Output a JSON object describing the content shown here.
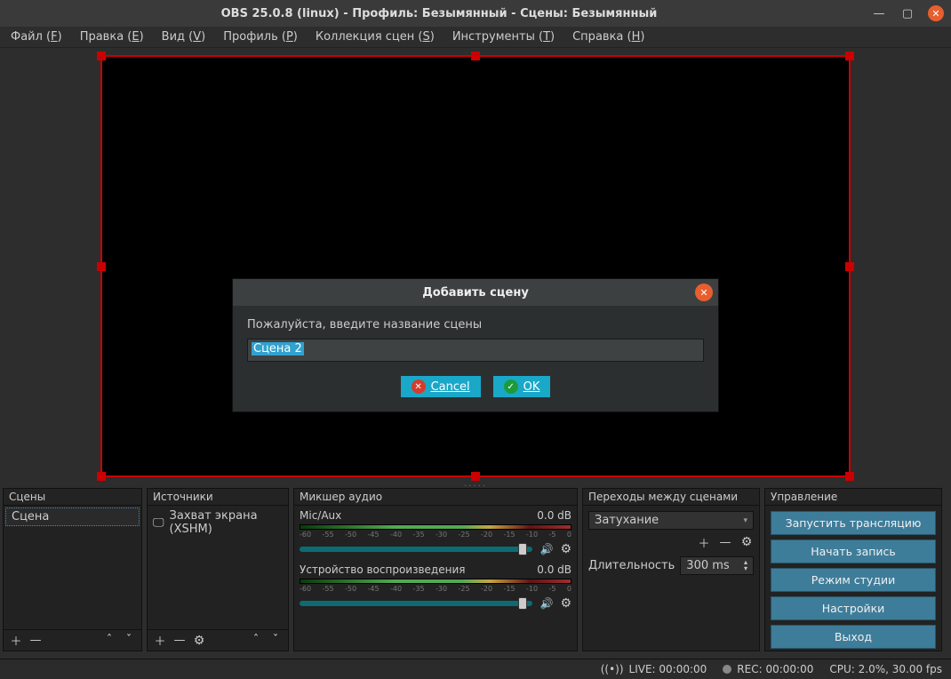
{
  "window": {
    "title": "OBS 25.0.8 (linux) - Профиль: Безымянный - Сцены: Безымянный"
  },
  "menubar": {
    "file": "Файл (",
    "file_u": "F",
    "edit": "Правка (",
    "edit_u": "E",
    "view": "Вид (",
    "view_u": "V",
    "profile": "Профиль (",
    "profile_u": "P",
    "scenecoll": "Коллекция сцен (",
    "scenecoll_u": "S",
    "tools": "Инструменты (",
    "tools_u": "T",
    "help": "Справка (",
    "help_u": "H",
    "close_paren": ")"
  },
  "panels": {
    "scenes": {
      "title": "Сцены",
      "items": [
        "Сцена"
      ]
    },
    "sources": {
      "title": "Источники",
      "items": [
        "Захват экрана (XSHM)"
      ]
    },
    "mixer": {
      "title": "Микшер аудио",
      "channels": [
        {
          "name": "Mic/Aux",
          "level": "0.0 dB"
        },
        {
          "name": "Устройство воспроизведения",
          "level": "0.0 dB"
        }
      ],
      "ticks": [
        "-60",
        "-55",
        "-50",
        "-45",
        "-40",
        "-35",
        "-30",
        "-25",
        "-20",
        "-15",
        "-10",
        "-5",
        "0"
      ]
    },
    "transitions": {
      "title": "Переходы между сценами",
      "selected": "Затухание",
      "duration_label": "Длительность",
      "duration_value": "300 ms"
    },
    "controls": {
      "title": "Управление",
      "buttons": {
        "start_stream": "Запустить трансляцию",
        "start_record": "Начать запись",
        "studio_mode": "Режим студии",
        "settings": "Настройки",
        "exit": "Выход"
      }
    }
  },
  "statusbar": {
    "live": "LIVE: 00:00:00",
    "rec": "REC: 00:00:00",
    "cpu": "CPU: 2.0%, 30.00 fps"
  },
  "dialog": {
    "title": "Добавить сцену",
    "label": "Пожалуйста, введите название сцены",
    "input_value": "Сцена 2",
    "cancel": "Cancel",
    "ok": "OK"
  }
}
